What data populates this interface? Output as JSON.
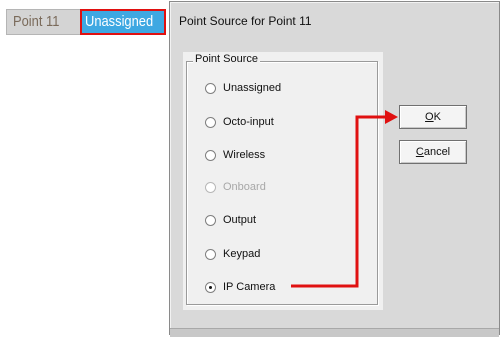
{
  "point": {
    "name": "Point 11",
    "status": "Unassigned"
  },
  "dialog": {
    "title": "Point Source for Point 11",
    "group_label": "Point Source",
    "options": [
      {
        "label": "Unassigned",
        "checked": false,
        "enabled": true
      },
      {
        "label": "Octo-input",
        "checked": false,
        "enabled": true
      },
      {
        "label": "Wireless",
        "checked": false,
        "enabled": true
      },
      {
        "label": "Onboard",
        "checked": false,
        "enabled": false
      },
      {
        "label": "Output",
        "checked": false,
        "enabled": true
      },
      {
        "label": "Keypad",
        "checked": false,
        "enabled": true
      },
      {
        "label": "IP Camera",
        "checked": true,
        "enabled": true
      }
    ],
    "ok": {
      "accel": "O",
      "rest": "K"
    },
    "cancel": {
      "accel": "C",
      "rest": "ancel"
    }
  },
  "colors": {
    "status_bg": "#3ea8e2",
    "highlight": "#e01010"
  }
}
